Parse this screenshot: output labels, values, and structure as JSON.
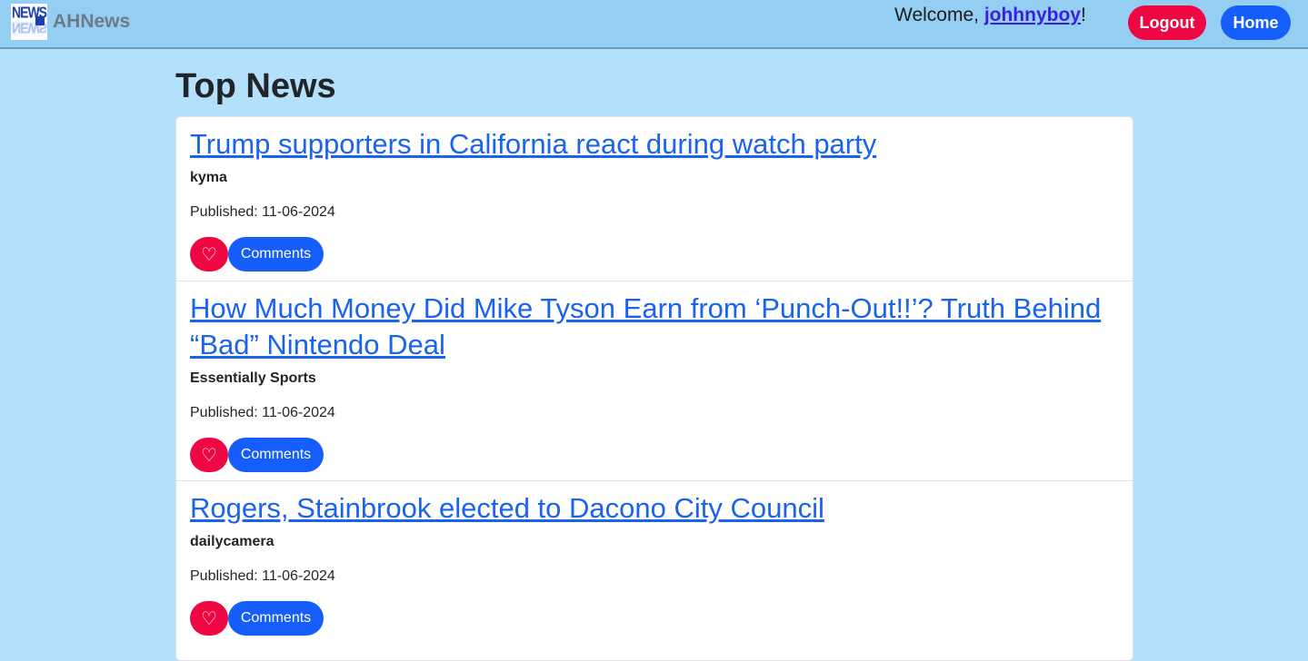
{
  "nav": {
    "logo_text": "NEWS",
    "brand": "AHNews",
    "welcome_prefix": "Welcome, ",
    "username": "johhnyboy",
    "welcome_suffix": "!",
    "logout_label": "Logout",
    "home_label": "Home"
  },
  "page": {
    "title": "Top News"
  },
  "articles": [
    {
      "title": "Trump supporters in California react during watch party",
      "source": "kyma",
      "published": "Published: 11-06-2024",
      "like_icon": "♡",
      "comments_label": "Comments"
    },
    {
      "title": "How Much Money Did Mike Tyson Earn from ‘Punch-Out!!’? Truth Behind “Bad” Nintendo Deal",
      "source": "Essentially Sports",
      "published": "Published: 11-06-2024",
      "like_icon": "♡",
      "comments_label": "Comments"
    },
    {
      "title": "Rogers, Stainbrook elected to Dacono City Council",
      "source": "dailycamera",
      "published": "Published: 11-06-2024",
      "like_icon": "♡",
      "comments_label": "Comments"
    }
  ],
  "colors": {
    "navbar": "#94cff3",
    "page_bg": "#b3e0fa",
    "danger": "#ee0743",
    "primary": "#155efb",
    "link": "#1a63ec"
  }
}
